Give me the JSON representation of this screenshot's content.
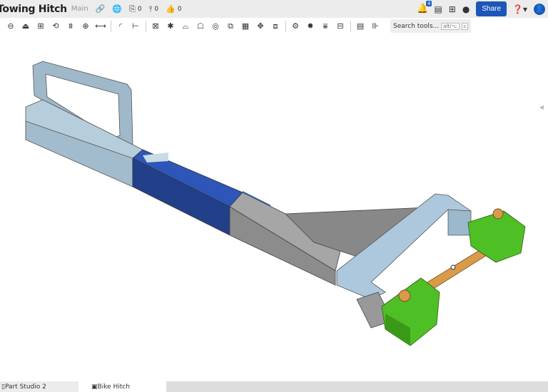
{
  "header": {
    "title": "Towing Hitch",
    "branch": "Main",
    "files_count": "0",
    "versions_count": "0",
    "likes_count": "0",
    "notifications": "4",
    "share_label": "Share"
  },
  "toolbar": {
    "groups": [
      [
        "sketch-icon",
        "extrude-icon",
        "revolve-icon",
        "sweep-icon",
        "loft-icon",
        "thicken-icon",
        "enclose-icon"
      ],
      [
        "fillet-icon",
        "chamfer-icon"
      ],
      [
        "draft-icon",
        "rib-icon",
        "shell-icon",
        "wrap-icon",
        "hole-icon",
        "boolean-icon",
        "split-icon",
        "transform-icon",
        "pattern-icon"
      ],
      [
        "mate-connector-icon",
        "gear-icon",
        "sheet-metal-icon",
        "frame-icon"
      ],
      [
        "variable-icon",
        "measure-icon"
      ]
    ],
    "search_label": "Search tools...",
    "search_shortcut": "alt/⌥",
    "search_key": "c"
  },
  "tabs": [
    {
      "label": "Part Studio 2",
      "active": false
    },
    {
      "label": "Bike Hitch",
      "active": true
    }
  ],
  "colors": {
    "accent": "#1b56b8",
    "tube": "#a9c3d6",
    "blue_section": "#2a4fa8",
    "gray_section": "#9a9a9a",
    "green_blocks": "#4fbf26",
    "axle": "#d99a4a"
  }
}
